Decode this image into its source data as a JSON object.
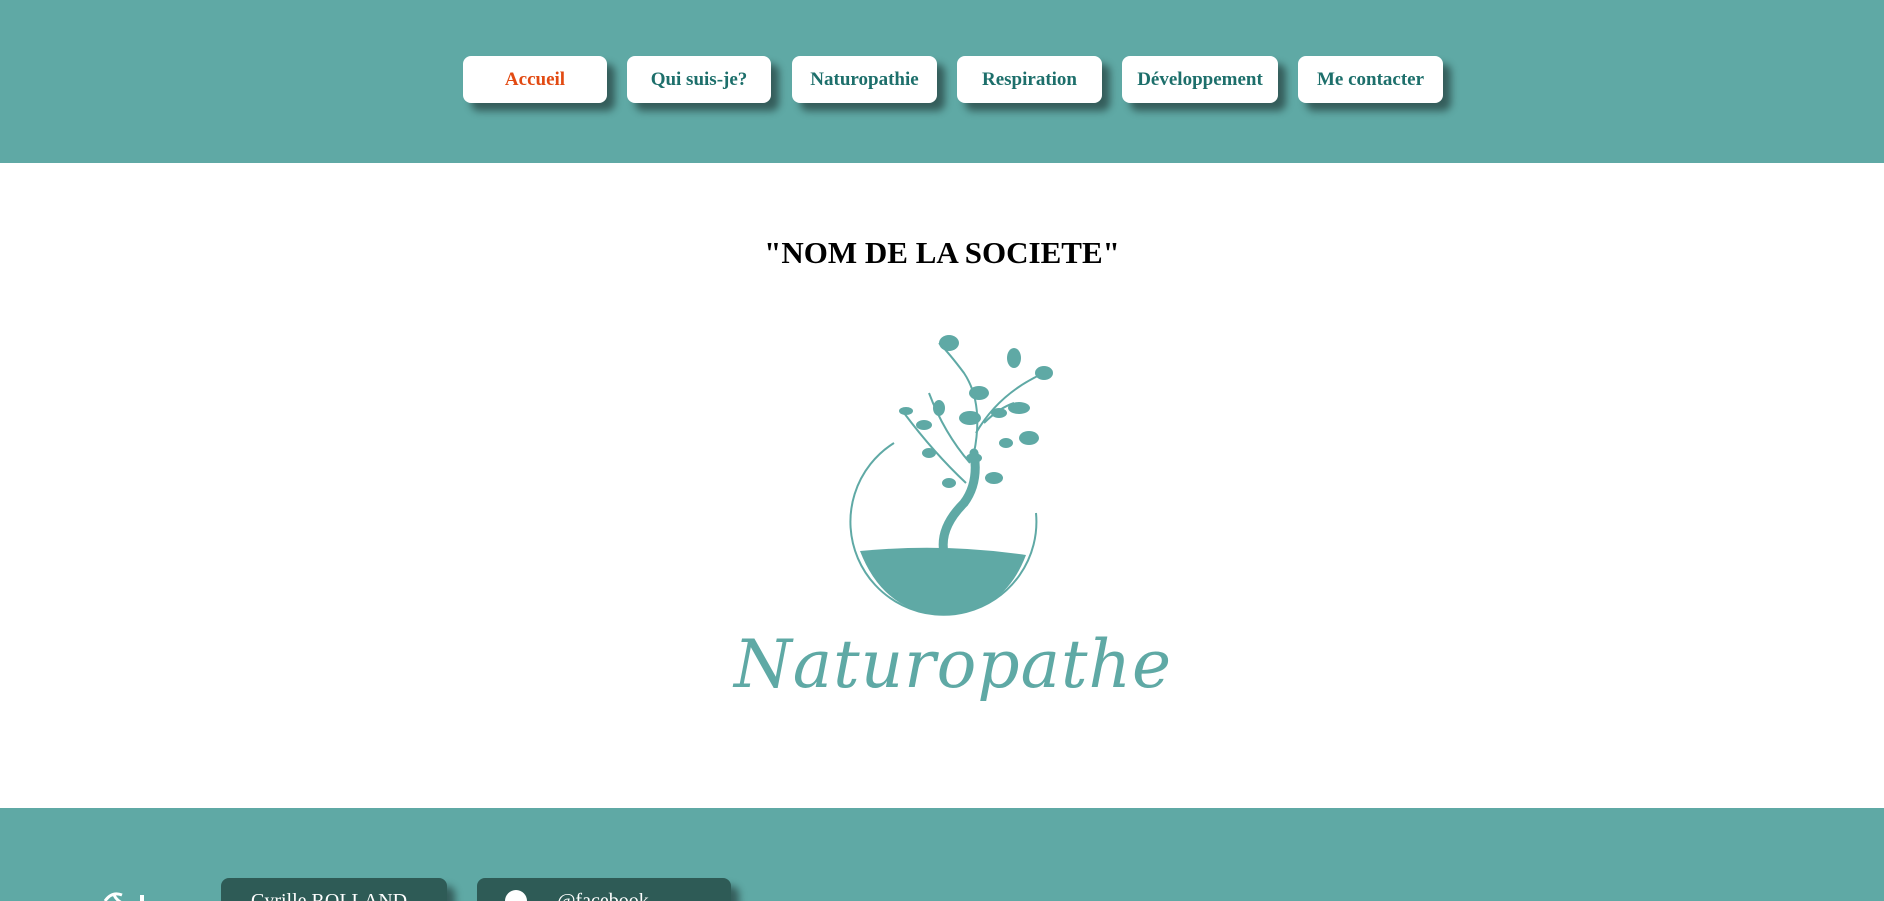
{
  "nav": {
    "items": [
      {
        "label": "Accueil",
        "active": true
      },
      {
        "label": "Qui suis-je?"
      },
      {
        "label": "Naturopathie"
      },
      {
        "label": "Respiration"
      },
      {
        "label": "Développement"
      },
      {
        "label": "Me contacter"
      }
    ]
  },
  "main": {
    "company_name": "\"NOM DE LA SOCIETE\"",
    "logo_text": "Naturopathe"
  },
  "footer": {
    "contact_name": "Cyrille ROLLAND",
    "facebook_handle": "@facebook"
  },
  "colors": {
    "brand_teal": "#5fa9a5",
    "active_nav": "#e24a12",
    "footer_button": "#2e5b56"
  }
}
